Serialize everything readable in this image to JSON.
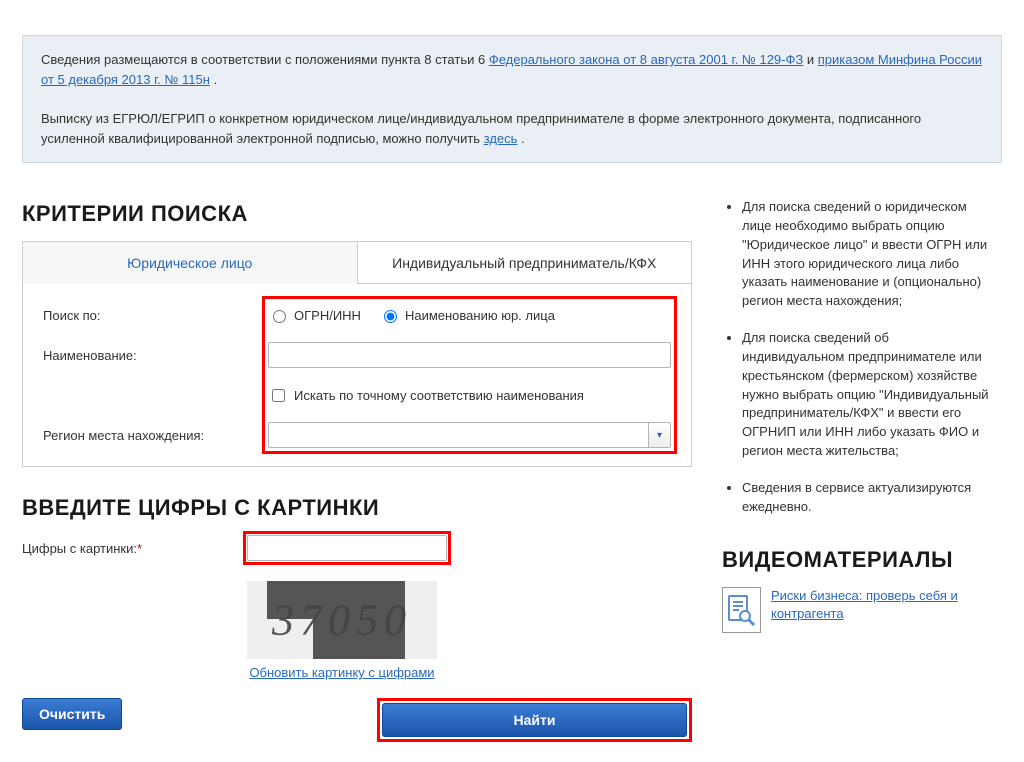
{
  "info_box": {
    "p1_prefix": "Сведения размещаются в соответствии с положениями пункта 8 статьи 6 ",
    "link_law": "Федерального закона от 8 августа 2001 г. № 129-ФЗ",
    "p1_mid": " и ",
    "link_order": "приказом Минфина России от 5 декабря 2013 г. № 115н",
    "p1_suffix": ".",
    "p2_prefix": "Выписку из ЕГРЮЛ/ЕГРИП о конкретном юридическом лице/индивидуальном предпринимателе в форме электронного документа, подписанного усиленной квалифицированной электронной подписью, можно получить ",
    "link_here": "здесь",
    "p2_suffix": "."
  },
  "criteria": {
    "title": "КРИТЕРИИ ПОИСКА",
    "tab_legal": "Юридическое лицо",
    "tab_ip": "Индивидуальный предприниматель/КФХ",
    "label_search_by": "Поиск по:",
    "radio_ogrn": "ОГРН/ИНН",
    "radio_name": "Наименованию юр. лица",
    "radio_selected": "name",
    "label_name": "Наименование:",
    "checkbox_exact": "Искать по точному соответствию наименования",
    "label_region": "Регион места нахождения:",
    "field_name_value": "",
    "region_value": ""
  },
  "captcha": {
    "title": "ВВЕДИТЕ ЦИФРЫ С КАРТИНКИ",
    "label": "Цифры с картинки:",
    "required_mark": "*",
    "value": "",
    "refresh_link": "Обновить картинку с цифрами",
    "depicted_digits": "37050"
  },
  "buttons": {
    "clear": "Очистить",
    "find": "Найти"
  },
  "hints": {
    "items": [
      "Для поиска сведений о юридическом лице необходимо выбрать опцию \"Юридическое лицо\" и ввести ОГРН или ИНН этого юридического лица либо указать наименование и (опционально) регион места нахождения;",
      "Для поиска сведений об индивидуальном предпринимателе или крестьянском (фермерском) хозяйстве нужно выбрать опцию \"Индивидуальный предприниматель/КФХ\" и ввести его ОГРНИП или ИНН либо указать ФИО и регион места жительства;",
      "Сведения в сервисе актуализируются ежедневно."
    ]
  },
  "video": {
    "title": "ВИДЕОМАТЕРИАЛЫ",
    "link_text": "Риски бизнеса: проверь себя и контрагента"
  }
}
